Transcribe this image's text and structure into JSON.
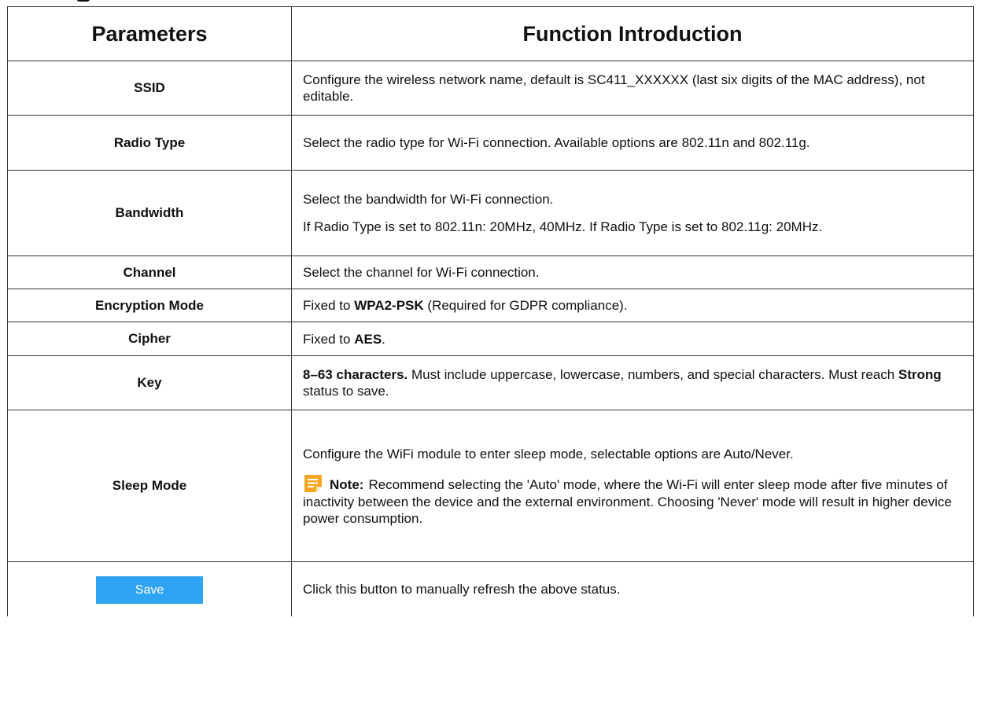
{
  "table": {
    "headers": [
      "Parameters",
      "Function Introduction"
    ],
    "rows": [
      {
        "name": "SSID",
        "desc": [
          "Configure the wireless network name, default is SC411_XXXXXX (last six digits of the MAC address), not editable."
        ]
      },
      {
        "name": "Radio Type",
        "desc": [
          "Select the radio type for Wi-Fi connection. Available options are 802.11n and 802.11g."
        ]
      },
      {
        "name": "Bandwidth",
        "desc": [
          "Select the bandwidth for Wi-Fi connection.",
          "If Radio Type is set to 802.11n: 20MHz, 40MHz. If Radio Type is set to 802.11g: 20MHz."
        ]
      },
      {
        "name": "Channel",
        "desc": [
          "Select the channel for Wi-Fi connection."
        ]
      },
      {
        "name": "Encryption Mode",
        "desc_parts": {
          "pre": "Fixed to ",
          "bold": "WPA2-PSK",
          "post": " (Required for GDPR compliance)."
        }
      },
      {
        "name": "Cipher",
        "desc_parts": {
          "pre": "Fixed to ",
          "bold": "AES",
          "post": "."
        }
      },
      {
        "name": "Key",
        "desc_parts": {
          "bold1": "8–63 characters.",
          "mid": " Must include uppercase, lowercase, numbers, and special characters. Must reach ",
          "bold2": "Strong",
          "post": " status to save."
        }
      },
      {
        "name": "Sleep Mode",
        "desc": [
          "Configure the WiFi module to enter sleep mode, selectable options are Auto/Never."
        ],
        "note": {
          "label": "Note:",
          "icon": "note-icon",
          "text": "Recommend selecting the 'Auto' mode, where the Wi-Fi will enter sleep mode after five minutes of inactivity between the device and the external environment. Choosing 'Never' mode will result in higher device power consumption."
        }
      }
    ],
    "save_row": {
      "button_label": "Save",
      "desc": "Click this button to manually refresh the above status."
    }
  },
  "colors": {
    "save_button": "#2fa4f2",
    "note_icon": "#f5a623",
    "border": "#333333"
  }
}
